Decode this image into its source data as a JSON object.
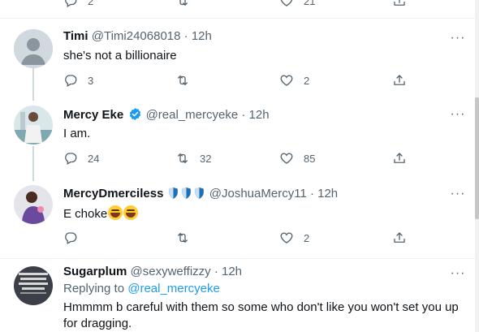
{
  "top_actions": {
    "reply_count": "2",
    "retweet_count": "",
    "like_count": "21"
  },
  "tweets": [
    {
      "name": "Timi",
      "handle": "@Timi24068018",
      "time": "12h",
      "text": "she's not a billionaire",
      "reply_count": "3",
      "retweet_count": "",
      "like_count": "2"
    },
    {
      "name": "Mercy Eke",
      "handle": "@real_mercyeke",
      "time": "12h",
      "text": "I am.",
      "reply_count": "24",
      "retweet_count": "32",
      "like_count": "85"
    },
    {
      "name": "MercyDmerciless",
      "handle": "@JoshuaMercy11",
      "time": "12h",
      "text": "E choke",
      "reply_count": "",
      "retweet_count": "",
      "like_count": "2"
    },
    {
      "name": "Sugarplum",
      "handle": "@sexyweffizzy",
      "time": "12h",
      "replying_label": "Replying to",
      "replying_to": "@real_mercyeke",
      "text": "Hmmmm b careful with them so some who don't like you won't set you up for  dragging."
    }
  ],
  "separator": "·",
  "more_label": "···",
  "icons": {
    "reply": "reply-icon",
    "retweet": "retweet-icon",
    "like": "heart-icon",
    "share": "share-icon",
    "more": "more-icon",
    "verified": "verified-badge-icon",
    "shield": "shield-icon",
    "emoji": "grinning-sweat-emoji-icon"
  },
  "colors": {
    "text": "#0f1419",
    "secondary": "#536471",
    "link": "#1d9bf0",
    "verified": "#1d9bf0",
    "shield": "#1d6fb8",
    "divider": "#eff3f4"
  }
}
